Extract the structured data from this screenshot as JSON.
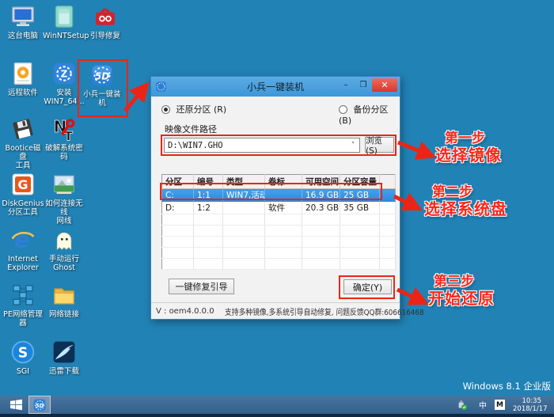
{
  "app": {
    "name": "小兵一键装机",
    "logo_glyph": "5D"
  },
  "desktop": {
    "background_color": "#2182b5",
    "icons": [
      {
        "label": "这台电脑"
      },
      {
        "label": "WinNTSetup"
      },
      {
        "label": "引导修复"
      },
      {
        "label": "远程软件"
      },
      {
        "label": "安装\nWIN7_64..."
      },
      {
        "label": "小兵一键装机",
        "glyph": "5D"
      },
      {
        "label": "Bootice磁盘\n工具"
      },
      {
        "label": "破解系统密码",
        "glyph": "N",
        "glyph2": "T"
      },
      {
        "label": "DiskGenius\n分区工具",
        "glyph": "G"
      },
      {
        "label": "如何连接无线\n网线"
      },
      {
        "label": "Internet\nExplorer",
        "glyph": "e"
      },
      {
        "label": "手动运行\nGhost"
      },
      {
        "label": "PE网络管理器"
      },
      {
        "label": "网络链接"
      },
      {
        "label": "SGI",
        "glyph": "S"
      },
      {
        "label": "迅雷下载"
      }
    ]
  },
  "dialog": {
    "title": "小兵一键装机",
    "window_buttons": {
      "minimize": "–",
      "maximize": "❒",
      "close": "✕"
    },
    "radio_restore": "还原分区 (R)",
    "radio_backup": "备份分区 (B)",
    "image_path_label": "映像文件路径",
    "image_path_value": "D:\\WIN7.GHO",
    "combo_arrow": "˅",
    "browse_button": "浏览(S)",
    "table": {
      "headers": [
        "分区",
        "编号",
        "类型",
        "卷标",
        "可用空间",
        "分区容量",
        ""
      ],
      "rows": [
        {
          "selected": true,
          "cells": [
            "C:",
            "1:1",
            "WIN7,活动",
            "",
            "16.9 GB",
            "25 GB"
          ]
        },
        {
          "selected": false,
          "cells": [
            "D:",
            "1:2",
            "",
            "软件",
            "20.3 GB",
            "35 GB"
          ]
        }
      ]
    },
    "repair_button": "一键修复引导",
    "ok_button": "确定(Y)",
    "status_version": "V : oem4.0.0.0",
    "status_info": "支持多种镜像,多系统引导自动修复, 问题反馈QQ群:606616468"
  },
  "annotations": {
    "highlight_color": "#ea2517",
    "steps": [
      {
        "step": "第一步",
        "action": "选择镜像"
      },
      {
        "step": "第二步",
        "action": "选择系统盘"
      },
      {
        "step": "第三步",
        "action": "开始还原"
      }
    ]
  },
  "taskbar": {
    "tray": {
      "ime_lang": "中",
      "ime_mode": "M",
      "time": "10:35",
      "date": "2018/1/17"
    }
  },
  "system": {
    "os_edition_label": "Windows 8.1 企业版"
  }
}
